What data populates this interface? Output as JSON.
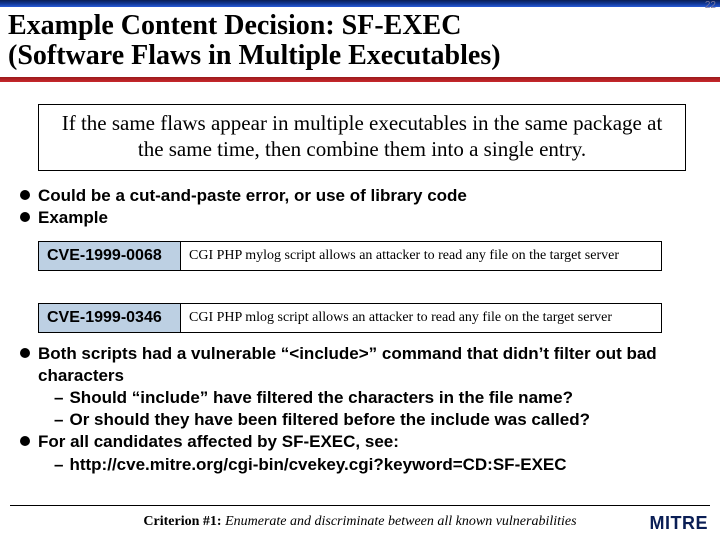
{
  "page_number": "22",
  "title_line1": "Example Content Decision: SF-EXEC",
  "title_line2": "(Software Flaws in Multiple Executables)",
  "callout": "If the same flaws appear in multiple executables in the same package at the same time, then combine them into a single entry.",
  "bullets_top": [
    "Could be a cut-and-paste error, or use of library code",
    "Example"
  ],
  "cve_rows": [
    {
      "id": "CVE-1999-0068",
      "desc": "CGI PHP mylog script allows an attacker to read any file on the target server"
    },
    {
      "id": "CVE-1999-0346",
      "desc": "CGI PHP mlog script allows an attacker to read any file on the target server"
    }
  ],
  "bullets_bottom": [
    {
      "text": "Both scripts had a vulnerable “<include>” command that didn’t filter out bad characters",
      "sub": [
        "Should “include” have filtered the characters in the file name?",
        "Or should they have been filtered before the include was called?"
      ]
    },
    {
      "text": "For all candidates affected by SF-EXEC, see:",
      "sub": [
        "http://cve.mitre.org/cgi-bin/cvekey.cgi?keyword=CD:SF-EXEC"
      ]
    }
  ],
  "footer": {
    "criterion_lead": "Criterion #1: ",
    "criterion_rest": "Enumerate and discriminate between all known vulnerabilities",
    "logo": "MITRE"
  }
}
